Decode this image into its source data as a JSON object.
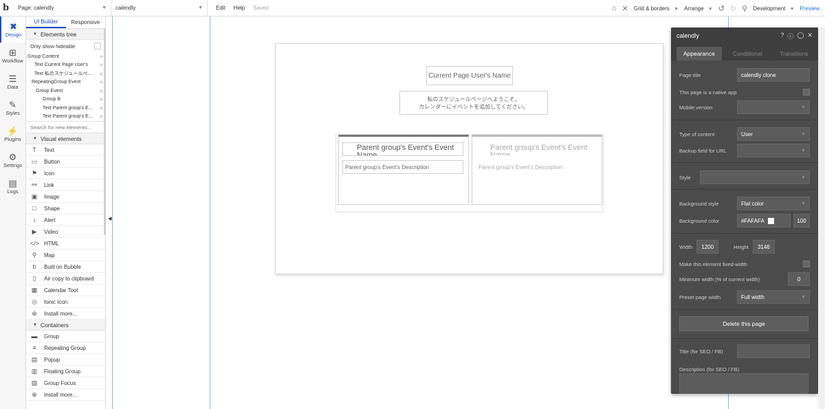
{
  "topbar": {
    "logo": "b",
    "page_select": "Page: calendly",
    "element_select": "calendly",
    "edit": "Edit",
    "help": "Help",
    "status": "Saved",
    "grid": "Grid & borders",
    "arrange": "Arrange",
    "env": "Development",
    "preview": "Preview"
  },
  "rail": [
    {
      "label": "Design",
      "icon": "design-icon"
    },
    {
      "label": "Workflow",
      "icon": "workflow-icon"
    },
    {
      "label": "Data",
      "icon": "data-icon"
    },
    {
      "label": "Styles",
      "icon": "styles-icon"
    },
    {
      "label": "Plugins",
      "icon": "plugins-icon"
    },
    {
      "label": "Settings",
      "icon": "settings-icon"
    },
    {
      "label": "Logs",
      "icon": "logs-icon"
    }
  ],
  "left_panel": {
    "tab_ui": "UI Builder",
    "tab_responsive": "Responsive",
    "elements_tree_title": "Elements tree",
    "only_hideable": "Only show hideable",
    "tree": [
      "Group Content",
      "Text Current Page User's",
      "Text 私のスケジュールペ...",
      "RepeatingGroup Event",
      "Group Event",
      "Group B",
      "Text Parent group's E...",
      "Text Parent group's E..."
    ],
    "search_placeholder": "Search for new elements...",
    "visual_title": "Visual elements",
    "visual": [
      "Text",
      "Button",
      "Icon",
      "Link",
      "Image",
      "Shape",
      "Alert",
      "Video",
      "HTML",
      "Map",
      "Built on Bubble",
      "Air copy to clipboard",
      "Calendar Tool",
      "Ionic Icon",
      "Install more..."
    ],
    "containers_title": "Containers",
    "containers": [
      "Group",
      "Repeating Group",
      "Popup",
      "Floating Group",
      "Group Focus",
      "Install more..."
    ]
  },
  "canvas": {
    "user_name": "Current Page User's Name",
    "welcome_line1": "私のスケジュールページへようこそ。",
    "welcome_line2": "カレンダーにイベントを追加してください。",
    "event_name": "Parent group's Event's Event Name",
    "event_desc": "Parent group's Event's Description"
  },
  "props": {
    "title": "calendly",
    "tab_appearance": "Appearance",
    "tab_conditional": "Conditional",
    "tab_transitions": "Transitions",
    "page_title_label": "Page title",
    "page_title_value": "calendly clone",
    "native_app": "This page is a native app",
    "mobile_version": "Mobile version",
    "type_of_content": "Type of content",
    "type_value": "User",
    "backup_field": "Backup field for URL",
    "style": "Style",
    "bg_style": "Background style",
    "bg_style_value": "Flat color",
    "bg_color": "Background color",
    "bg_color_value": "#FAFAFA",
    "bg_opacity": "100",
    "width_label": "Width",
    "width_value": "1200",
    "height_label": "Height",
    "height_value": "3146",
    "fixed_width": "Make this element fixed-width",
    "min_width": "Minimum width (% of current width)",
    "min_width_value": "0",
    "preset_width": "Preset page width",
    "preset_value": "Full width",
    "delete": "Delete this page",
    "seo_title": "Title (for SEO / FB)",
    "seo_desc": "Description (for SEO / FB)"
  }
}
